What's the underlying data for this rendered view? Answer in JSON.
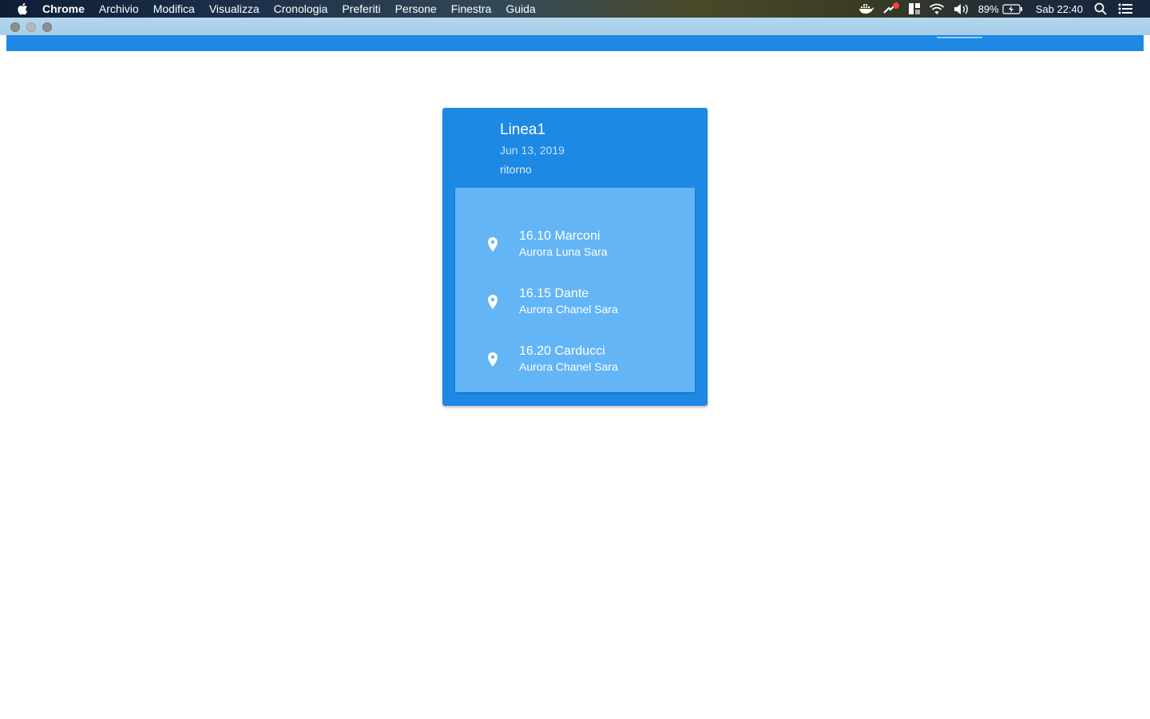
{
  "menubar": {
    "app": "Chrome",
    "items": [
      "Archivio",
      "Modifica",
      "Visualizza",
      "Cronologia",
      "Preferiti",
      "Persone",
      "Finestra",
      "Guida"
    ],
    "battery": "89%",
    "clock": "Sab 22:40",
    "tray_icons": [
      "docker-icon",
      "notification-icon",
      "split-view-icon",
      "wifi-icon",
      "volume-icon"
    ]
  },
  "card": {
    "title": "Linea1",
    "date": "Jun 13, 2019",
    "direction": "ritorno",
    "stops": [
      {
        "title": "16.10 Marconi",
        "people": "Aurora Luna Sara"
      },
      {
        "title": "16.15 Dante",
        "people": "Aurora Chanel Sara"
      },
      {
        "title": "16.20 Carducci",
        "people": "Aurora Chanel Sara"
      }
    ]
  },
  "colors": {
    "primary": "#1e88e5",
    "stops_background": "#64b5f6",
    "titlebar": "#a6cde9"
  }
}
